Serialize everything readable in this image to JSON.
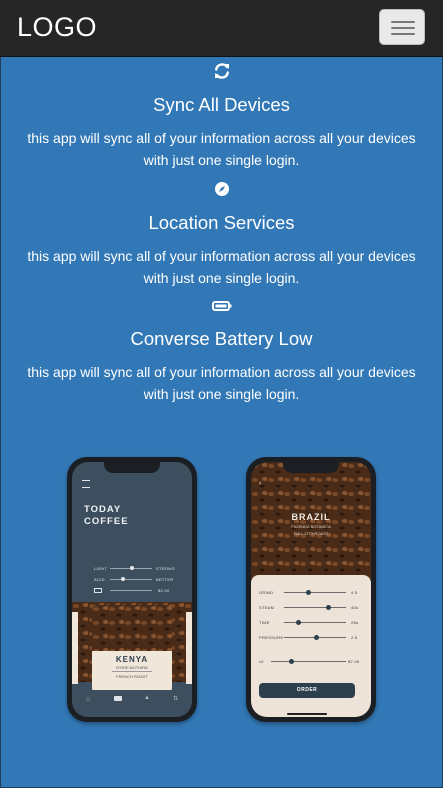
{
  "header": {
    "logo": "LOGO",
    "menu_icon": "hamburger-icon"
  },
  "features": [
    {
      "icon": "sync-icon",
      "title": "Sync All Devices",
      "text_line1": "this app will sync all of your information across all your devices",
      "text_line2": "with just one single login."
    },
    {
      "icon": "compass-icon",
      "title": "Location Services",
      "text_line1": "this app will sync all of your information across all your devices",
      "text_line2": "with just one single login."
    },
    {
      "icon": "battery-icon",
      "title": "Converse Battery Low",
      "text_line1": "this app will sync all of your information across all your devices",
      "text_line2": "with just one single login."
    }
  ],
  "phone_left": {
    "title_line1": "TODAY",
    "title_line2": "COFFEE",
    "slider1_left": "LIGHT",
    "slider1_right": "STRONG",
    "slider2_left": "ACID",
    "slider2_right": "BETTER",
    "slider3_right": "$2.00",
    "card_title": "KENYA",
    "card_sub": "NYERI MUTHIRA",
    "card_roast": "FRENCH ROAST",
    "tabs": [
      "home-icon",
      "cup-icon",
      "bell-icon",
      "swap-icon"
    ]
  },
  "phone_right": {
    "title": "BRAZIL",
    "sub1": "FAZENDA BOTANICA",
    "sub2": "FULL CITY ROAST",
    "rows": [
      {
        "label": "GRIND",
        "value": "4.5"
      },
      {
        "label": "STEAM",
        "value": "40s"
      },
      {
        "label": "TIME",
        "value": "28s"
      },
      {
        "label": "PRESSURE",
        "value": "2.5"
      }
    ],
    "price_label": "x2",
    "price_value": "$7.00",
    "order_button": "ORDER"
  },
  "colors": {
    "background": "#3278b6",
    "navbar": "#262626",
    "menu_button": "#e9e9e9"
  }
}
